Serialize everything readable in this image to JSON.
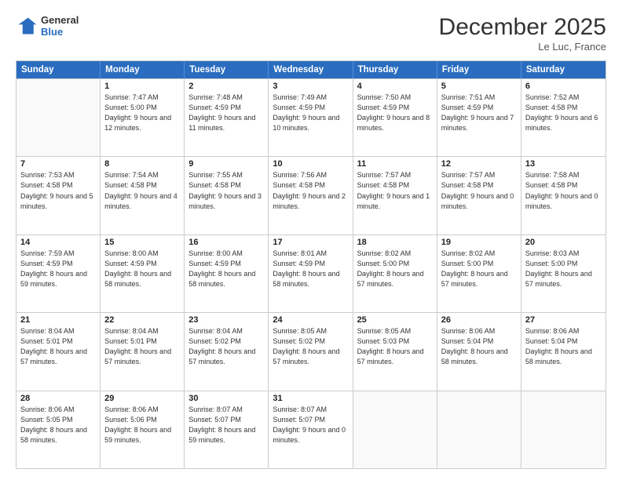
{
  "logo": {
    "line1": "General",
    "line2": "Blue"
  },
  "title": "December 2025",
  "location": "Le Luc, France",
  "days_of_week": [
    "Sunday",
    "Monday",
    "Tuesday",
    "Wednesday",
    "Thursday",
    "Friday",
    "Saturday"
  ],
  "weeks": [
    [
      {
        "day": "",
        "sunrise": "",
        "sunset": "",
        "daylight": ""
      },
      {
        "day": "1",
        "sunrise": "7:47 AM",
        "sunset": "5:00 PM",
        "daylight": "9 hours and 12 minutes."
      },
      {
        "day": "2",
        "sunrise": "7:48 AM",
        "sunset": "4:59 PM",
        "daylight": "9 hours and 11 minutes."
      },
      {
        "day": "3",
        "sunrise": "7:49 AM",
        "sunset": "4:59 PM",
        "daylight": "9 hours and 10 minutes."
      },
      {
        "day": "4",
        "sunrise": "7:50 AM",
        "sunset": "4:59 PM",
        "daylight": "9 hours and 8 minutes."
      },
      {
        "day": "5",
        "sunrise": "7:51 AM",
        "sunset": "4:59 PM",
        "daylight": "9 hours and 7 minutes."
      },
      {
        "day": "6",
        "sunrise": "7:52 AM",
        "sunset": "4:58 PM",
        "daylight": "9 hours and 6 minutes."
      }
    ],
    [
      {
        "day": "7",
        "sunrise": "7:53 AM",
        "sunset": "4:58 PM",
        "daylight": "9 hours and 5 minutes."
      },
      {
        "day": "8",
        "sunrise": "7:54 AM",
        "sunset": "4:58 PM",
        "daylight": "9 hours and 4 minutes."
      },
      {
        "day": "9",
        "sunrise": "7:55 AM",
        "sunset": "4:58 PM",
        "daylight": "9 hours and 3 minutes."
      },
      {
        "day": "10",
        "sunrise": "7:56 AM",
        "sunset": "4:58 PM",
        "daylight": "9 hours and 2 minutes."
      },
      {
        "day": "11",
        "sunrise": "7:57 AM",
        "sunset": "4:58 PM",
        "daylight": "9 hours and 1 minute."
      },
      {
        "day": "12",
        "sunrise": "7:57 AM",
        "sunset": "4:58 PM",
        "daylight": "9 hours and 0 minutes."
      },
      {
        "day": "13",
        "sunrise": "7:58 AM",
        "sunset": "4:58 PM",
        "daylight": "9 hours and 0 minutes."
      }
    ],
    [
      {
        "day": "14",
        "sunrise": "7:59 AM",
        "sunset": "4:59 PM",
        "daylight": "8 hours and 59 minutes."
      },
      {
        "day": "15",
        "sunrise": "8:00 AM",
        "sunset": "4:59 PM",
        "daylight": "8 hours and 58 minutes."
      },
      {
        "day": "16",
        "sunrise": "8:00 AM",
        "sunset": "4:59 PM",
        "daylight": "8 hours and 58 minutes."
      },
      {
        "day": "17",
        "sunrise": "8:01 AM",
        "sunset": "4:59 PM",
        "daylight": "8 hours and 58 minutes."
      },
      {
        "day": "18",
        "sunrise": "8:02 AM",
        "sunset": "5:00 PM",
        "daylight": "8 hours and 57 minutes."
      },
      {
        "day": "19",
        "sunrise": "8:02 AM",
        "sunset": "5:00 PM",
        "daylight": "8 hours and 57 minutes."
      },
      {
        "day": "20",
        "sunrise": "8:03 AM",
        "sunset": "5:00 PM",
        "daylight": "8 hours and 57 minutes."
      }
    ],
    [
      {
        "day": "21",
        "sunrise": "8:04 AM",
        "sunset": "5:01 PM",
        "daylight": "8 hours and 57 minutes."
      },
      {
        "day": "22",
        "sunrise": "8:04 AM",
        "sunset": "5:01 PM",
        "daylight": "8 hours and 57 minutes."
      },
      {
        "day": "23",
        "sunrise": "8:04 AM",
        "sunset": "5:02 PM",
        "daylight": "8 hours and 57 minutes."
      },
      {
        "day": "24",
        "sunrise": "8:05 AM",
        "sunset": "5:02 PM",
        "daylight": "8 hours and 57 minutes."
      },
      {
        "day": "25",
        "sunrise": "8:05 AM",
        "sunset": "5:03 PM",
        "daylight": "8 hours and 57 minutes."
      },
      {
        "day": "26",
        "sunrise": "8:06 AM",
        "sunset": "5:04 PM",
        "daylight": "8 hours and 58 minutes."
      },
      {
        "day": "27",
        "sunrise": "8:06 AM",
        "sunset": "5:04 PM",
        "daylight": "8 hours and 58 minutes."
      }
    ],
    [
      {
        "day": "28",
        "sunrise": "8:06 AM",
        "sunset": "5:05 PM",
        "daylight": "8 hours and 58 minutes."
      },
      {
        "day": "29",
        "sunrise": "8:06 AM",
        "sunset": "5:06 PM",
        "daylight": "8 hours and 59 minutes."
      },
      {
        "day": "30",
        "sunrise": "8:07 AM",
        "sunset": "5:07 PM",
        "daylight": "8 hours and 59 minutes."
      },
      {
        "day": "31",
        "sunrise": "8:07 AM",
        "sunset": "5:07 PM",
        "daylight": "9 hours and 0 minutes."
      },
      {
        "day": "",
        "sunrise": "",
        "sunset": "",
        "daylight": ""
      },
      {
        "day": "",
        "sunrise": "",
        "sunset": "",
        "daylight": ""
      },
      {
        "day": "",
        "sunrise": "",
        "sunset": "",
        "daylight": ""
      }
    ]
  ]
}
